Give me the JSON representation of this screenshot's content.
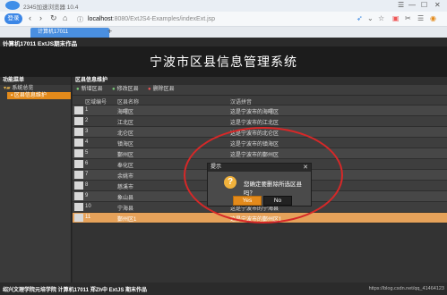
{
  "browser": {
    "title": "2345加速浏览器 10.4",
    "login_label": "登录",
    "url_host": "localhost",
    "url_path": ":8080/ExtJS4-Examples/indexExt.jsp",
    "tab_label": "计算机17011",
    "new_tab": "+"
  },
  "app": {
    "header": "计算机17011 ExtJS期末作品",
    "banner_title": "宁波市区县信息管理系统",
    "west_title": "功能菜单",
    "tree": [
      "系统总览",
      "区县信息维护"
    ],
    "center_title": "区县信息维护",
    "toolbar": {
      "add": "新增区县",
      "edit": "修改区县",
      "delete": "删除区县"
    },
    "columns": [
      "区域编号",
      "区县名称",
      "汉语拼音"
    ],
    "rows": [
      {
        "id": "1",
        "name": "海曙区",
        "desc": "这是宁波市的海曙区"
      },
      {
        "id": "2",
        "name": "江北区",
        "desc": "这是宁波市的江北区"
      },
      {
        "id": "3",
        "name": "北仑区",
        "desc": "这是宁波市的北仑区"
      },
      {
        "id": "4",
        "name": "镇海区",
        "desc": "这是宁波市的镇海区"
      },
      {
        "id": "5",
        "name": "鄞州区",
        "desc": "这是宁波市的鄞州区"
      },
      {
        "id": "6",
        "name": "奉化区",
        "desc": ""
      },
      {
        "id": "7",
        "name": "余姚市",
        "desc": ""
      },
      {
        "id": "8",
        "name": "慈溪市",
        "desc": ""
      },
      {
        "id": "9",
        "name": "象山县",
        "desc": ""
      },
      {
        "id": "10",
        "name": "宁海县",
        "desc": "这是宁波市的宁海县"
      },
      {
        "id": "11",
        "name": "鄞州区1",
        "desc": "这是宁波市的鄞州区1"
      }
    ],
    "footer_left": "绍兴文理学院元培学院 计算机17011 郑Zh中 ExtJS 期末作品",
    "footer_right": "https://blog.csdn.net/qq_41464123"
  },
  "dialog": {
    "title": "提示",
    "message": "您确定要删除所选区县吗？",
    "yes": "Yes",
    "no": "No"
  },
  "colors": {
    "accent": "#e38a1b",
    "selected_row": "#e6a25a",
    "annotation_circle": "#d62828"
  }
}
